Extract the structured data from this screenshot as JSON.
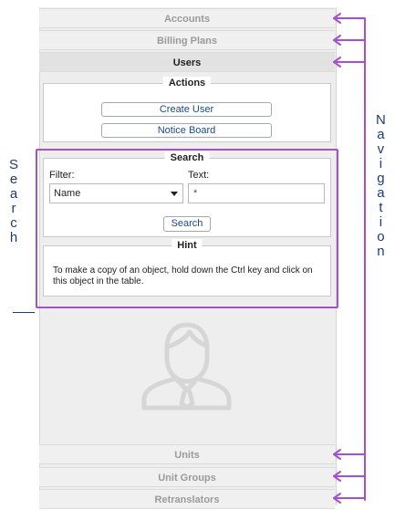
{
  "navigation": {
    "top_items": [
      {
        "label": "Accounts"
      },
      {
        "label": "Billing Plans"
      },
      {
        "label": "Users"
      }
    ],
    "bottom_items": [
      {
        "label": "Units"
      },
      {
        "label": "Unit Groups"
      },
      {
        "label": "Retranslators"
      }
    ],
    "active": "Users"
  },
  "actions": {
    "legend": "Actions",
    "create_user_label": "Create User",
    "notice_board_label": "Notice Board"
  },
  "search": {
    "legend": "Search",
    "filter_label": "Filter:",
    "filter_value": "Name",
    "text_label": "Text:",
    "text_value": "*",
    "search_button_label": "Search"
  },
  "hint": {
    "legend": "Hint",
    "text": "To make a copy of an object, hold down the Ctrl key and click on this object in the table."
  },
  "annotations": {
    "left_word_letters": [
      "S",
      "e",
      "a",
      "r",
      "c",
      "h"
    ],
    "right_word_letters": [
      "N",
      "a",
      "v",
      "i",
      "g",
      "a",
      "t",
      "i",
      "o",
      "n"
    ],
    "highlight_color": "#a64fd2",
    "text_color": "#1a3d7a"
  },
  "icons": {
    "placeholder": "user-silhouette-icon",
    "arrows": "arrow-left-icon"
  }
}
